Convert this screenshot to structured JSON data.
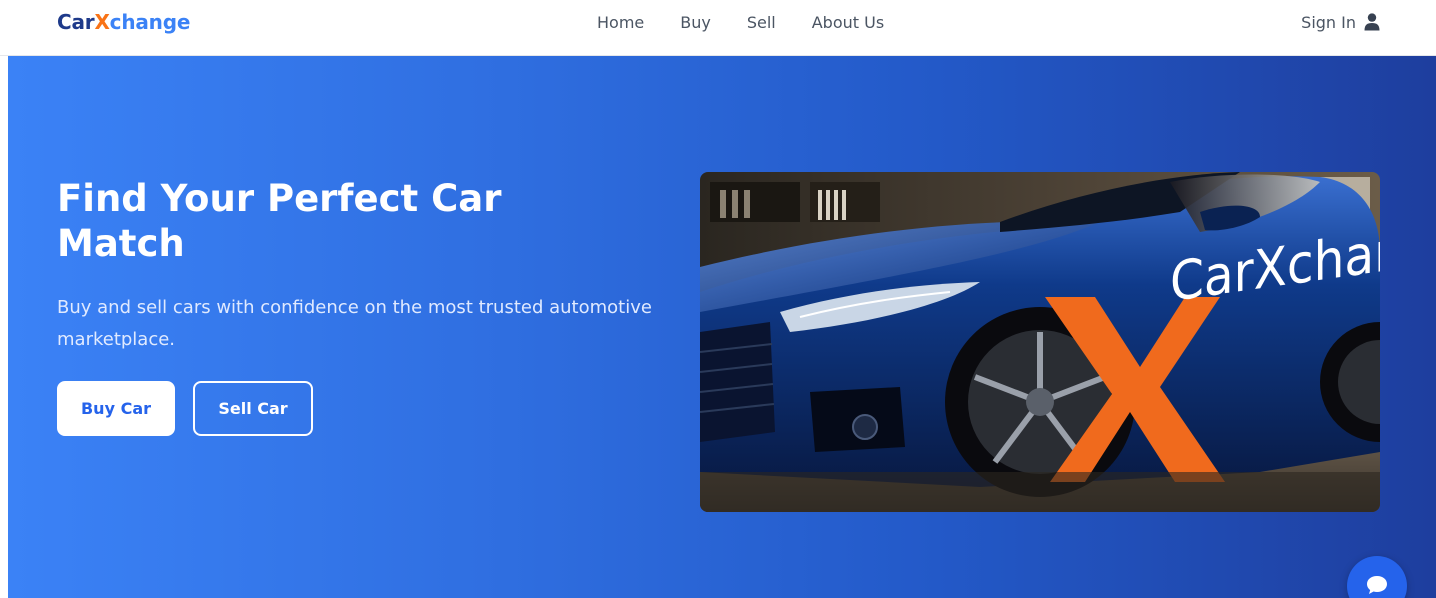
{
  "brand": {
    "part1": "Car",
    "part2": "X",
    "part3": "change"
  },
  "nav": {
    "links": [
      "Home",
      "Buy",
      "Sell",
      "About Us"
    ],
    "signin_label": "Sign In",
    "signin_icon": "user-icon"
  },
  "hero": {
    "title": "Find Your Perfect Car Match",
    "subtitle": "Buy and sell cars with confidence on the most trusted automotive marketplace.",
    "buy_button": "Buy Car",
    "sell_button": "Sell Car",
    "image_logo_text": "CarXchange",
    "image_logo_mark": "X"
  },
  "chat": {
    "icon": "chat-bubble-icon"
  },
  "colors": {
    "primary": "#2563eb",
    "accent_orange": "#f97316",
    "brand_dark": "#1e3a8a",
    "hero_start": "#3b82f6",
    "hero_end": "#1e3e9e"
  }
}
